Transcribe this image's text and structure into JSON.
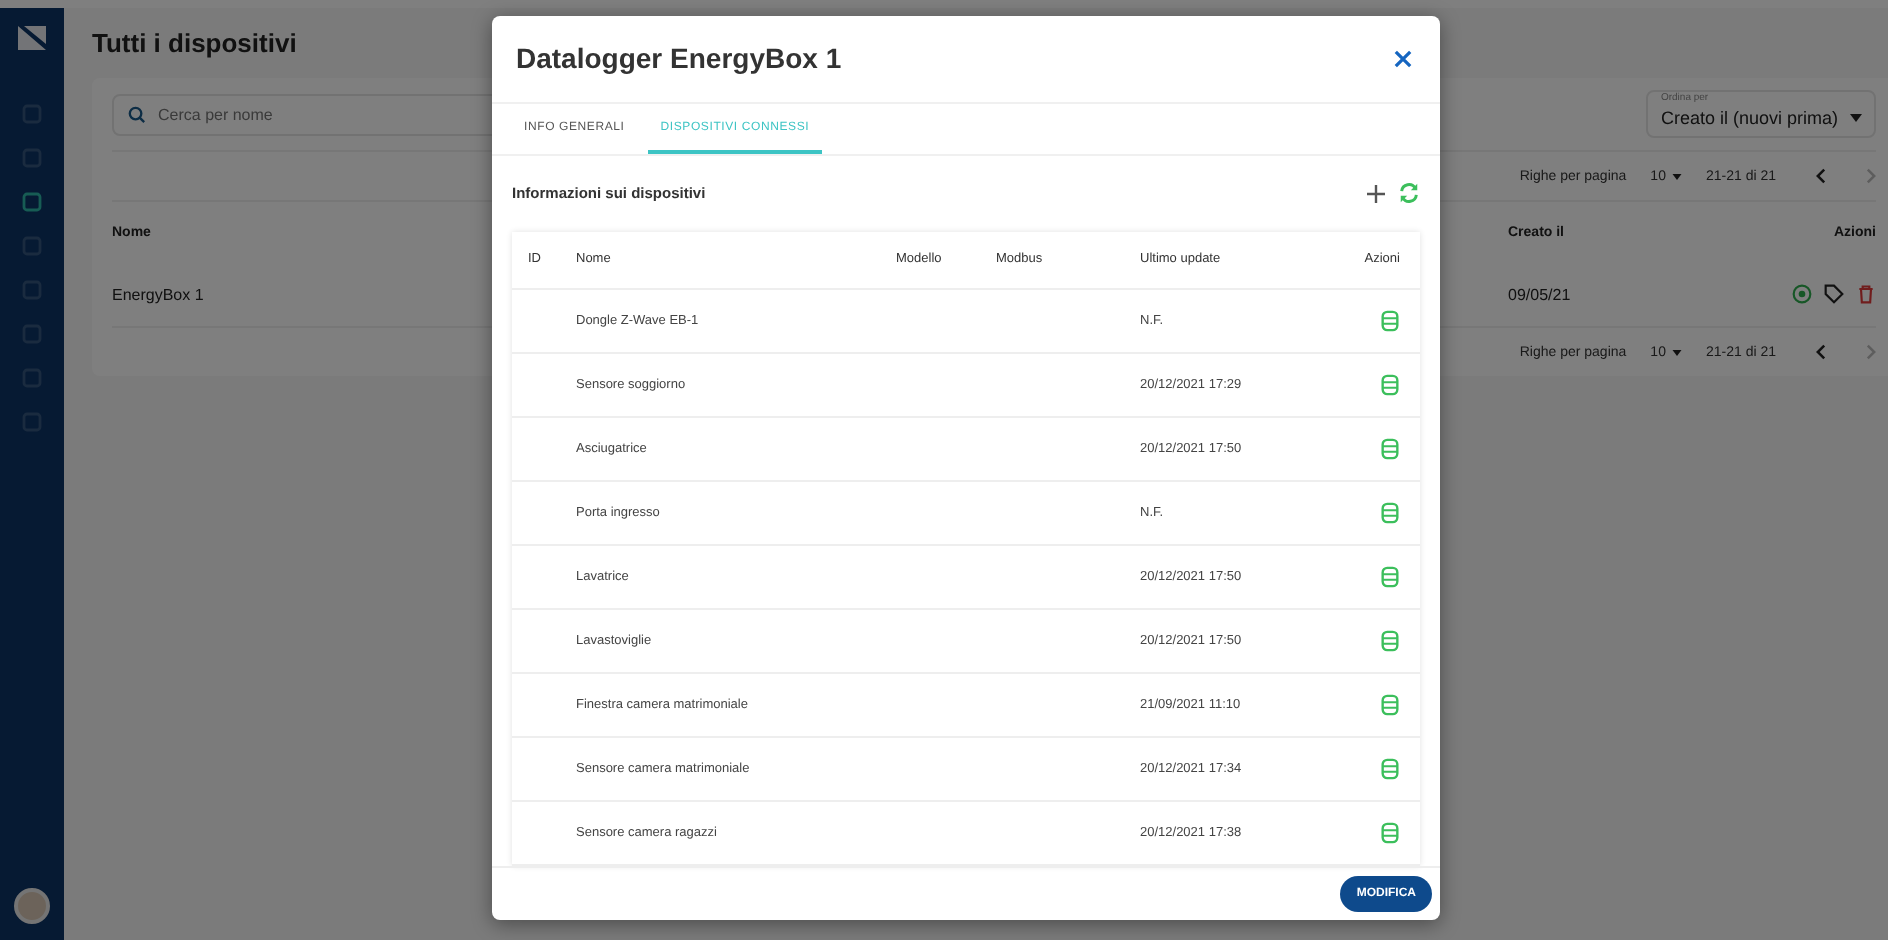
{
  "sidebar": {
    "items": [
      {
        "selected": false
      },
      {
        "selected": false
      },
      {
        "selected": true
      },
      {
        "selected": false
      },
      {
        "selected": false
      },
      {
        "selected": false
      },
      {
        "selected": false
      },
      {
        "selected": false
      }
    ]
  },
  "page": {
    "title": "Tutti i dispositivi",
    "search": {
      "placeholder": "Cerca per nome"
    },
    "sort": {
      "label": "Ordina per",
      "value": "Creato il (nuovi prima)"
    },
    "pagination_top": {
      "rows_label": "Righe per pagina",
      "rows_value": "10",
      "range": "21-21 di 21"
    },
    "table": {
      "columns": [
        "Nome",
        "Creato il",
        "Azioni"
      ],
      "rows": [
        {
          "name": "EnergyBox 1",
          "created": "09/05/21"
        }
      ]
    },
    "pagination_bottom": {
      "rows_label": "Righe per pagina",
      "rows_value": "10",
      "range": "21-21 di 21"
    }
  },
  "modal": {
    "title": "Datalogger EnergyBox 1",
    "tabs": [
      {
        "label": "INFO GENERALI",
        "selected": false
      },
      {
        "label": "DISPOSITIVI CONNESSI",
        "selected": true
      }
    ],
    "section_title": "Informazioni sui dispositivi",
    "table": {
      "columns": [
        "ID",
        "Nome",
        "Modello",
        "Modbus",
        "Ultimo update",
        "Azioni"
      ],
      "rows": [
        {
          "name": "Dongle Z-Wave EB-1",
          "updated": "N.F."
        },
        {
          "name": "Sensore soggiorno",
          "updated": "20/12/2021 17:29"
        },
        {
          "name": "Asciugatrice",
          "updated": "20/12/2021 17:50"
        },
        {
          "name": "Porta ingresso",
          "updated": "N.F."
        },
        {
          "name": "Lavatrice",
          "updated": "20/12/2021 17:50"
        },
        {
          "name": "Lavastoviglie",
          "updated": "20/12/2021 17:50"
        },
        {
          "name": "Finestra camera matrimoniale",
          "updated": "21/09/2021 11:10"
        },
        {
          "name": "Sensore camera matrimoniale",
          "updated": "20/12/2021 17:34"
        },
        {
          "name": "Sensore camera ragazzi",
          "updated": "20/12/2021 17:38"
        }
      ]
    },
    "button": "MODIFICA"
  }
}
